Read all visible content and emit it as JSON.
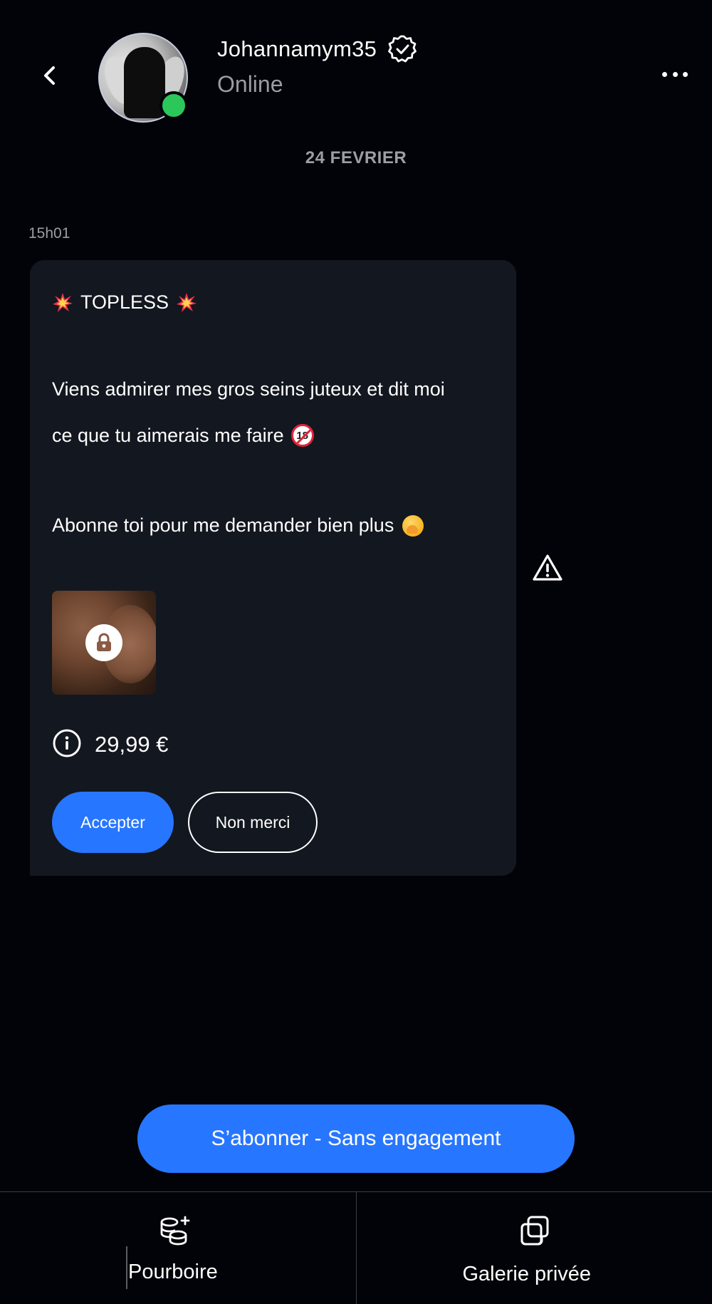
{
  "header": {
    "username": "Johannamym35",
    "status": "Online",
    "verified_icon": "verified-badge-icon",
    "back_icon": "chevron-left-icon",
    "menu_icon": "more-horizontal-icon"
  },
  "conversation": {
    "date_separator": "24 FEVRIER",
    "message": {
      "time": "15h01",
      "title": "TOPLESS",
      "title_emoji": "collision-emoji",
      "line1": "Viens admirer mes gros seins juteux et dit moi",
      "line2": "ce que tu aimerais me faire",
      "line2_emoji": "no-under-18-emoji",
      "line3": "Abonne toi pour me demander bien plus",
      "line3_emoji": "hand-over-mouth-emoji",
      "locked_media_icon": "lock-icon",
      "price": "29,99 €",
      "price_icon": "info-icon",
      "accept_label": "Accepter",
      "decline_label": "Non merci"
    },
    "report_icon": "warning-icon"
  },
  "subscribe": {
    "label": "S’abonner - Sans engagement"
  },
  "bottom_tabs": [
    {
      "label": "Pourboire",
      "icon": "coins-plus-icon"
    },
    {
      "label": "Galerie privée",
      "icon": "copy-gallery-icon"
    }
  ],
  "colors": {
    "background": "#020308",
    "bubble": "#13171f",
    "accent": "#2776ff",
    "online": "#2bc75a",
    "muted_text": "#9c9ea5"
  }
}
